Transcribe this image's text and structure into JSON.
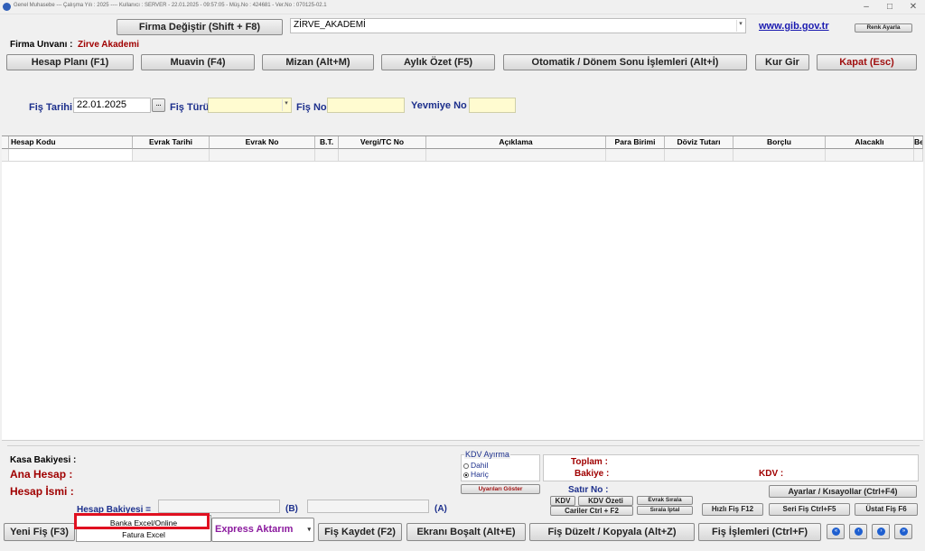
{
  "titlebar": {
    "text": "Genel Muhasebe --- Çalışma Yılı : 2025 ---- Kullanıcı : SERVER - 22.01.2025 - 09:57:05 - Müş.No : 424681 - Ver.No : 070125-02.1"
  },
  "top": {
    "firma_degistir": "Firma Değiştir (Shift + F8)",
    "firma_select_value": "ZİRVE_AKADEMİ",
    "gib_link": "www.gib.gov.tr",
    "renk_ayarla": "Renk Ayarla",
    "firma_unvani_label": "Firma Unvanı :",
    "firma_unvani_value": "Zirve Akademi"
  },
  "menu": {
    "hesap_plani": "Hesap Planı (F1)",
    "muavin": "Muavin (F4)",
    "mizan": "Mizan (Alt+M)",
    "aylik_ozet": "Aylık Özet (F5)",
    "otomatik": "Otomatik / Dönem Sonu İşlemleri (Alt+İ)",
    "kur_gir": "Kur Gir",
    "kapat": "Kapat (Esc)"
  },
  "fis": {
    "tarih_label": "Fiş Tarihi",
    "tarih_value": "22.01.2025",
    "ellipsis": "...",
    "turu_label": "Fiş Türü",
    "no_label": "Fiş No",
    "yevmiye_label": "Yevmiye No"
  },
  "grid": {
    "columns": [
      "Hesap Kodu",
      "Evrak Tarihi",
      "Evrak No",
      "B.T.",
      "Vergi/TC No",
      "Açıklama",
      "Para Birimi",
      "Döviz Tutarı",
      "Borçlu",
      "Alacaklı",
      "Be"
    ]
  },
  "bottom": {
    "kasa_bakiyesi": "Kasa Bakiyesi :",
    "ana_hesap": "Ana Hesap :",
    "hesap_ismi": "Hesap İsmi :",
    "hesap_bakiyesi": "Hesap Bakiyesi =",
    "b_label": "(B)",
    "a_label": "(A)",
    "kdv_ayirma": "KDV Ayırma",
    "dahil": "Dahil",
    "haric": "Hariç",
    "uyarilari_goster": "Uyarıları Göster",
    "toplam": "Toplam :",
    "bakiye": "Bakiye :",
    "kdv": "KDV :",
    "satir_no": "Satır No :",
    "kdv_btn": "KDV",
    "kdv_ozeti": "KDV Özeti",
    "evrak_sirala": "Evrak Sırala",
    "cariler": "Cariler Ctrl + F2",
    "sirala_iptal": "Sırala İptal",
    "ayarlar": "Ayarlar / Kısayollar (Ctrl+F4)",
    "hizli_fis": "Hızlı Fiş F12",
    "seri_fis": "Seri Fiş Ctrl+F5",
    "ustat_fis": "Üstat Fiş F6"
  },
  "footer": {
    "yeni_fis": "Yeni Fiş (F3)",
    "express_aktarim": "Express Aktarım",
    "fis_kaydet": "Fiş Kaydet (F2)",
    "ekrani_bosalt": "Ekranı Boşalt (Alt+E)",
    "fis_duzelt": "Fiş Düzelt / Kopyala (Alt+Z)",
    "fis_islemleri": "Fiş İşlemleri (Ctrl+F)"
  },
  "popup": {
    "items": [
      "Banka Excel/Online",
      "Fatura Excel"
    ]
  },
  "colors": {
    "accent_red": "#a00000",
    "label_blue": "#1c2f8c",
    "highlight": "#e01020"
  }
}
